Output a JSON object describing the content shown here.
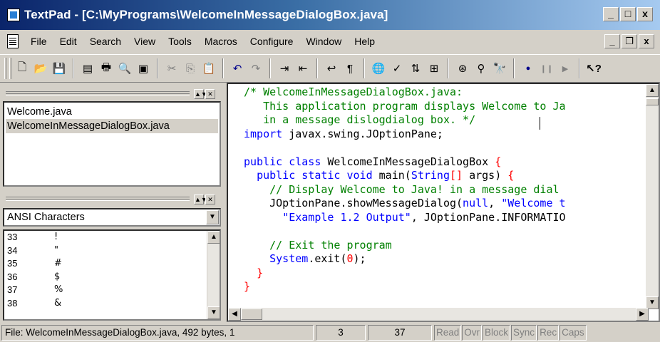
{
  "window": {
    "title": "TextPad - [C:\\MyPrograms\\WelcomeInMessageDialogBox.java]",
    "controls": [
      "_",
      "□",
      "x"
    ]
  },
  "menubar": {
    "items": [
      "File",
      "Edit",
      "Search",
      "View",
      "Tools",
      "Macros",
      "Configure",
      "Window",
      "Help"
    ],
    "mdi_controls": [
      "_",
      "❐",
      "x"
    ]
  },
  "toolbar": {
    "icons": [
      "new-icon",
      "open-icon",
      "save-icon",
      "save-all-icon",
      "print-icon",
      "print-preview-icon",
      "spelling-icon",
      "cut-icon",
      "copy-icon",
      "paste-icon",
      "undo-icon",
      "redo-icon",
      "indent-icon",
      "outdent-icon",
      "word-wrap-icon",
      "pilcrow-icon",
      "browser-icon",
      "spell-check-icon",
      "sort-icon",
      "compare-icon",
      "find-icon",
      "find-next-icon",
      "find-in-files-icon",
      "record-macro-icon",
      "playback-icon",
      "play-icon",
      "help-icon"
    ]
  },
  "documents_pane": {
    "files": [
      {
        "name": "Welcome.java",
        "selected": false
      },
      {
        "name": "WelcomeInMessageDialogBox.java",
        "selected": true
      }
    ]
  },
  "clip_library": {
    "selected": "ANSI Characters",
    "rows": [
      {
        "code": "33",
        "glyph": "!"
      },
      {
        "code": "34",
        "glyph": "\""
      },
      {
        "code": "35",
        "glyph": "#"
      },
      {
        "code": "36",
        "glyph": "$"
      },
      {
        "code": "37",
        "glyph": "%"
      },
      {
        "code": "38",
        "glyph": "&"
      }
    ]
  },
  "editor": {
    "lines": [
      [
        {
          "t": "c",
          "s": "/* WelcomeInMessageDialogBox.java:"
        }
      ],
      [
        {
          "t": "c",
          "s": "   This application program displays Welcome to Ja"
        }
      ],
      [
        {
          "t": "c",
          "s": "   in a message dislogdialog box. */"
        }
      ],
      [
        {
          "t": "k",
          "s": "import"
        },
        {
          "t": "x",
          "s": " javax.swing.JOptionPane;"
        }
      ],
      [
        {
          "t": "x",
          "s": ""
        }
      ],
      [
        {
          "t": "k",
          "s": "public class"
        },
        {
          "t": "x",
          "s": " WelcomeInMessageDialogBox "
        },
        {
          "t": "b",
          "s": "{"
        }
      ],
      [
        {
          "t": "x",
          "s": "  "
        },
        {
          "t": "k",
          "s": "public static void"
        },
        {
          "t": "x",
          "s": " main("
        },
        {
          "t": "k",
          "s": "String"
        },
        {
          "t": "b",
          "s": "[]"
        },
        {
          "t": "x",
          "s": " args) "
        },
        {
          "t": "b",
          "s": "{"
        }
      ],
      [
        {
          "t": "c",
          "s": "    // Display Welcome to Java! in a message dial"
        }
      ],
      [
        {
          "t": "x",
          "s": "    JOptionPane.showMessageDialog("
        },
        {
          "t": "k",
          "s": "null"
        },
        {
          "t": "x",
          "s": ", "
        },
        {
          "t": "k",
          "s": "\"Welcome t"
        }
      ],
      [
        {
          "t": "x",
          "s": "      "
        },
        {
          "t": "k",
          "s": "\"Example 1.2 Output\""
        },
        {
          "t": "x",
          "s": ", JOptionPane.INFORMATIO"
        }
      ],
      [
        {
          "t": "x",
          "s": ""
        }
      ],
      [
        {
          "t": "c",
          "s": "    // Exit the program"
        }
      ],
      [
        {
          "t": "x",
          "s": "    "
        },
        {
          "t": "k",
          "s": "System"
        },
        {
          "t": "x",
          "s": ".exit("
        },
        {
          "t": "n",
          "s": "0"
        },
        {
          "t": "x",
          "s": ");"
        }
      ],
      [
        {
          "t": "x",
          "s": "  "
        },
        {
          "t": "b",
          "s": "}"
        }
      ],
      [
        {
          "t": "b",
          "s": "}"
        }
      ]
    ]
  },
  "statusbar": {
    "file_info": "File: WelcomeInMessageDialogBox.java, 492 bytes, 1",
    "line": "3",
    "column": "37",
    "indicators": [
      "Read",
      "Ovr",
      "Block",
      "Sync",
      "Rec",
      "Caps"
    ]
  }
}
